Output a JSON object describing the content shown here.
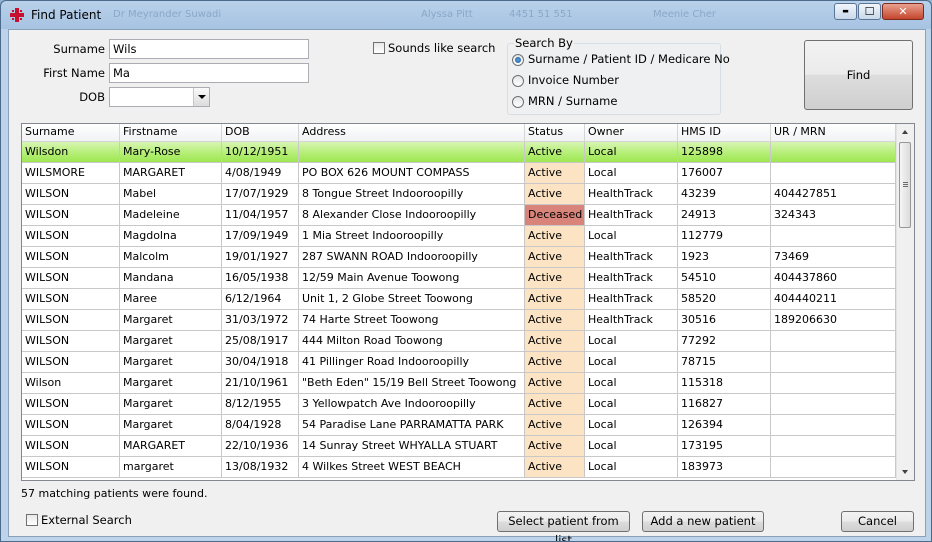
{
  "window": {
    "title": "Find Patient",
    "background_titles": [
      "Dr Meyrander Suwadi",
      "Alyssa Pitt",
      "4451 51 551",
      "Meenie Cher"
    ],
    "controls": {
      "minimize": "▬",
      "maximize": "☐",
      "close": "✕"
    }
  },
  "form": {
    "surname_label": "Surname",
    "surname_value": "Wils",
    "firstname_label": "First Name",
    "firstname_value": "Ma",
    "dob_label": "DOB",
    "dob_value": "",
    "sounds_like_label": "Sounds like search",
    "sounds_like_checked": false
  },
  "search_by": {
    "title": "Search By",
    "options": [
      {
        "label": "Surname / Patient ID / Medicare No",
        "selected": true
      },
      {
        "label": "Invoice Number",
        "selected": false
      },
      {
        "label": "MRN / Surname",
        "selected": false
      }
    ]
  },
  "find_button": "Find",
  "grid": {
    "columns": [
      "Surname",
      "Firstname",
      "DOB",
      "Address",
      "Status",
      "Owner",
      "HMS ID",
      "UR / MRN"
    ],
    "rows": [
      {
        "surname": "Wilsdon",
        "firstname": "Mary-Rose",
        "dob": "10/12/1951",
        "address": "",
        "status": "Active",
        "owner": "Local",
        "hms_id": "125898",
        "ur_mrn": ""
      },
      {
        "surname": "WILSMORE",
        "firstname": "MARGARET",
        "dob": "4/08/1949",
        "address": "PO BOX 626  MOUNT COMPASS",
        "status": "Active",
        "owner": "Local",
        "hms_id": "176007",
        "ur_mrn": ""
      },
      {
        "surname": "WILSON",
        "firstname": "Mabel",
        "dob": "17/07/1929",
        "address": "8 Tongue Street  Indooroopilly",
        "status": "Active",
        "owner": "HealthTrack",
        "hms_id": "43239",
        "ur_mrn": "404427851"
      },
      {
        "surname": "WILSON",
        "firstname": "Madeleine",
        "dob": "11/04/1957",
        "address": "8 Alexander Close  Indooroopilly",
        "status": "Deceased",
        "owner": "HealthTrack",
        "hms_id": "24913",
        "ur_mrn": "324343"
      },
      {
        "surname": "WILSON",
        "firstname": "Magdolna",
        "dob": "17/09/1949",
        "address": "1 Mia Street  Indooroopilly",
        "status": "Active",
        "owner": "Local",
        "hms_id": "112779",
        "ur_mrn": ""
      },
      {
        "surname": "WILSON",
        "firstname": "Malcolm",
        "dob": "19/01/1927",
        "address": "287 SWANN ROAD  Indooroopilly",
        "status": "Active",
        "owner": "HealthTrack",
        "hms_id": "1923",
        "ur_mrn": "73469"
      },
      {
        "surname": "WILSON",
        "firstname": "Mandana",
        "dob": "16/05/1938",
        "address": "12/59 Main Avenue  Toowong",
        "status": "Active",
        "owner": "HealthTrack",
        "hms_id": "54510",
        "ur_mrn": "404437860"
      },
      {
        "surname": "WILSON",
        "firstname": "Maree",
        "dob": "6/12/1964",
        "address": "Unit 1, 2 Globe Street  Toowong",
        "status": "Active",
        "owner": "HealthTrack",
        "hms_id": "58520",
        "ur_mrn": "404440211"
      },
      {
        "surname": "WILSON",
        "firstname": "Margaret",
        "dob": "31/03/1972",
        "address": "74 Harte Street  Toowong",
        "status": "Active",
        "owner": "HealthTrack",
        "hms_id": "30516",
        "ur_mrn": "189206630"
      },
      {
        "surname": "WILSON",
        "firstname": "Margaret",
        "dob": "25/08/1917",
        "address": "444 Milton Road  Toowong",
        "status": "Active",
        "owner": "Local",
        "hms_id": "77292",
        "ur_mrn": ""
      },
      {
        "surname": "WILSON",
        "firstname": "Margaret",
        "dob": "30/04/1918",
        "address": "41 Pillinger Road  Indooroopilly",
        "status": "Active",
        "owner": "Local",
        "hms_id": "78715",
        "ur_mrn": ""
      },
      {
        "surname": "Wilson",
        "firstname": "Margaret",
        "dob": "21/10/1961",
        "address": "\"Beth Eden\" 15/19 Bell Street Toowong",
        "status": "Active",
        "owner": "Local",
        "hms_id": "115318",
        "ur_mrn": ""
      },
      {
        "surname": "WILSON",
        "firstname": "Margaret",
        "dob": "8/12/1955",
        "address": "3 Yellowpatch Ave  Indooroopilly",
        "status": "Active",
        "owner": "Local",
        "hms_id": "116827",
        "ur_mrn": ""
      },
      {
        "surname": "WILSON",
        "firstname": "Margaret",
        "dob": "8/04/1928",
        "address": "54 Paradise Lane  PARRAMATTA PARK",
        "status": "Active",
        "owner": "Local",
        "hms_id": "126394",
        "ur_mrn": ""
      },
      {
        "surname": "WILSON",
        "firstname": "MARGARET",
        "dob": "22/10/1936",
        "address": "14 Sunray Street  WHYALLA STUART",
        "status": "Active",
        "owner": "Local",
        "hms_id": "173195",
        "ur_mrn": ""
      },
      {
        "surname": "WILSON",
        "firstname": "margaret",
        "dob": "13/08/1932",
        "address": "4 Wilkes Street  WEST BEACH",
        "status": "Active",
        "owner": "Local",
        "hms_id": "183973",
        "ur_mrn": ""
      }
    ],
    "selected_index": 0,
    "status_colors": {
      "Active": "#fbe3c4",
      "Deceased": "#d9847a",
      "selected": "#b6ef79"
    }
  },
  "result_text": "57 matching patients were found.",
  "external_search_label": "External Search",
  "external_search_checked": false,
  "buttons": {
    "select": "Select patient from list",
    "add": "Add a new patient",
    "cancel": "Cancel"
  }
}
